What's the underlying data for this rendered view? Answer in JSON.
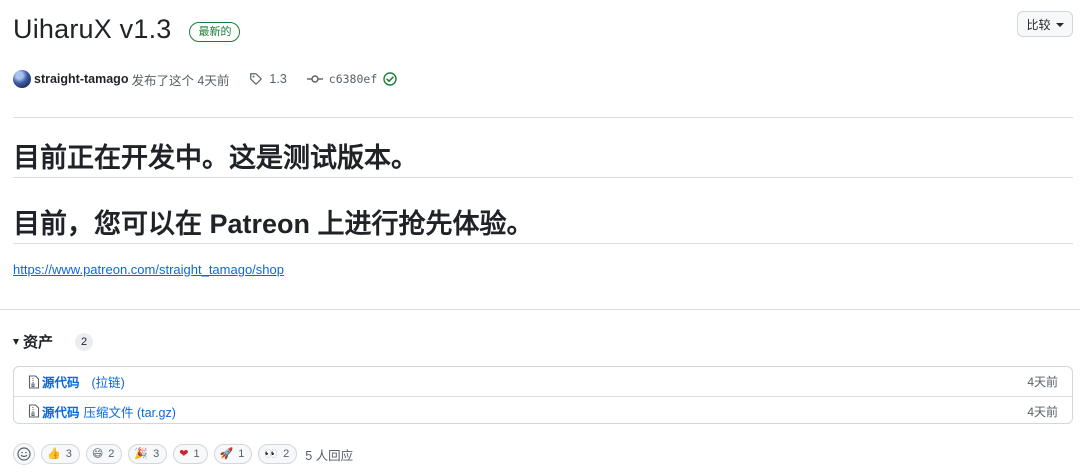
{
  "release": {
    "title": "UiharuX v1.3",
    "latest_badge": "最新的",
    "compare_label": "比较"
  },
  "meta": {
    "author": "straight-tamago",
    "published_text": "发布了这个 4天前",
    "tag": "1.3",
    "commit": "c6380ef"
  },
  "body": {
    "heading1": "目前正在开发中。这是测试版本。",
    "heading2": "目前，您可以在 Patreon 上进行抢先体验。",
    "link": "https://www.patreon.com/straight_tamago/shop"
  },
  "assets": {
    "title": "资产",
    "count": "2",
    "items": [
      {
        "name": "源代码",
        "sub": "(拉链)",
        "date": "4天前"
      },
      {
        "name": "源代码",
        "sub": "压缩文件 (tar.gz)",
        "date": "4天前"
      }
    ]
  },
  "reactions": {
    "items": [
      {
        "emoji": "👍",
        "count": "3"
      },
      {
        "emoji": "😄",
        "count": "2"
      },
      {
        "emoji": "🎉",
        "count": "3"
      },
      {
        "emoji": "❤",
        "count": "1"
      },
      {
        "emoji": "🚀",
        "count": "1"
      },
      {
        "emoji": "👀",
        "count": "2"
      }
    ],
    "summary": "5 人回应"
  },
  "colors": {
    "link": "#0969da",
    "success": "#1a7f37",
    "border": "#d0d7de"
  }
}
